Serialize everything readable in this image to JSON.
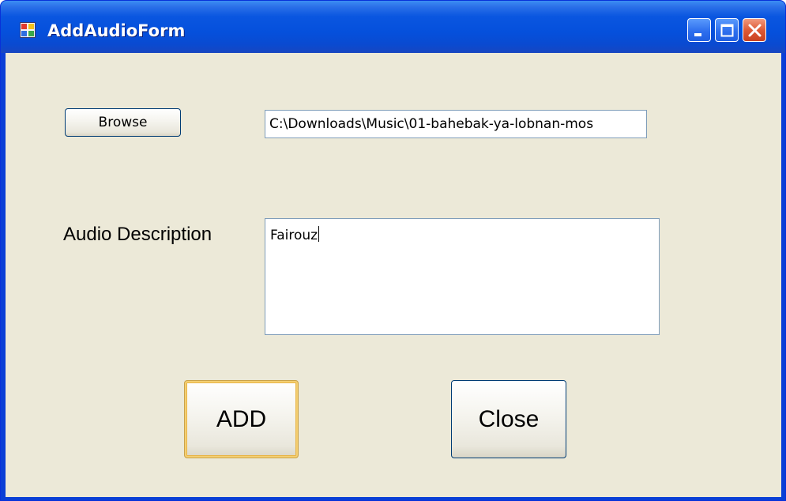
{
  "window": {
    "title": "AddAudioForm",
    "app_icon": "form-app-icon",
    "controls": {
      "minimize_icon": "minimize-icon",
      "maximize_icon": "maximize-icon",
      "close_icon": "close-icon"
    }
  },
  "form": {
    "browse_label": "Browse",
    "file_path_value": "C:\\Downloads\\Music\\01-bahebak-ya-lobnan-mos",
    "description_label": "Audio Description",
    "description_value": "Fairouz",
    "add_label": "ADD",
    "close_label": "Close"
  },
  "colors": {
    "title_bar": "#0a56e0",
    "client_background": "#ece9d8",
    "close_button": "#de5a36",
    "default_button_focus": "#f4cf72"
  }
}
